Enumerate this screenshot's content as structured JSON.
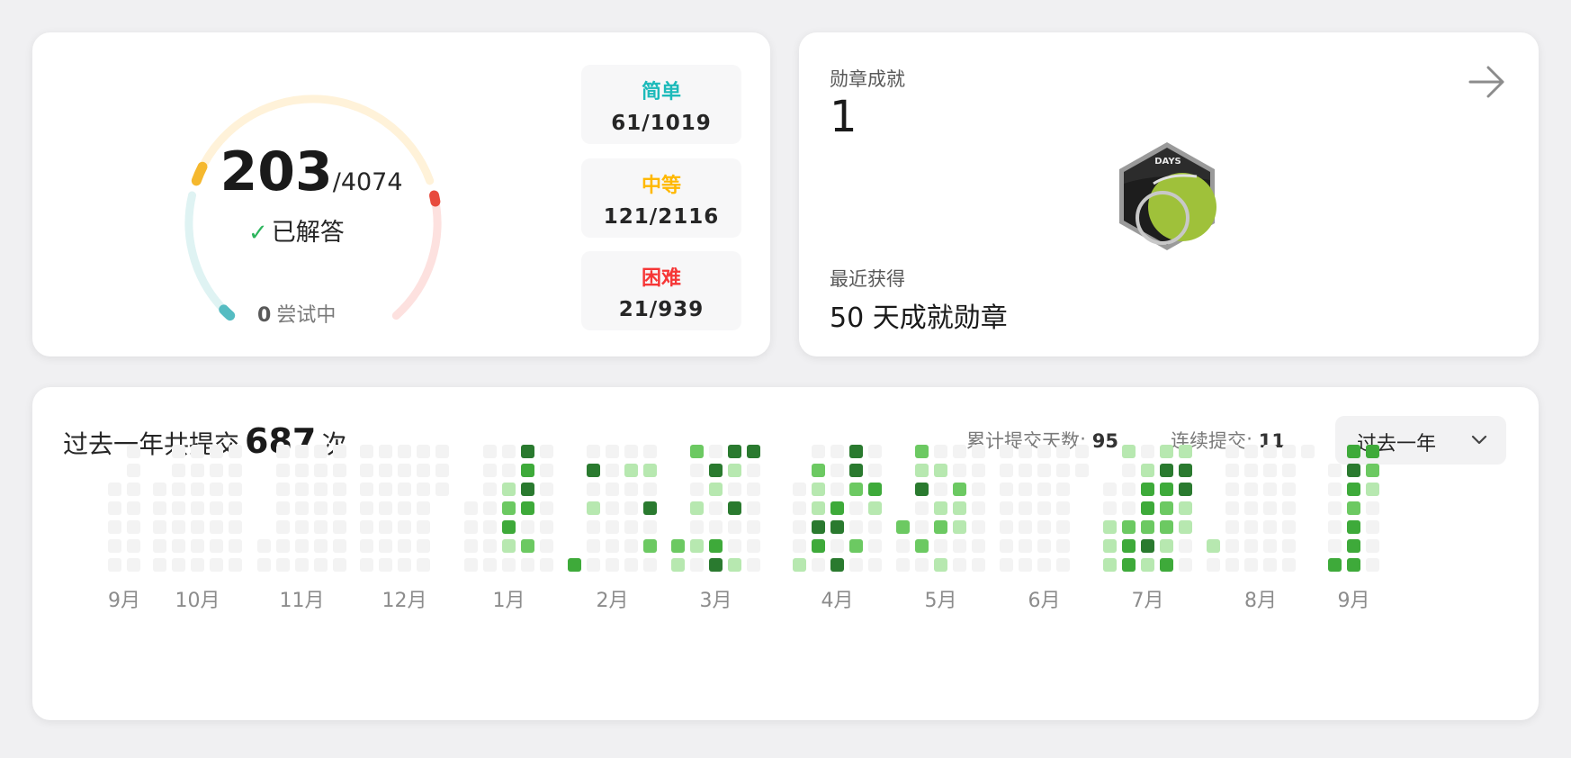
{
  "progress": {
    "solved": "203",
    "total": "/4074",
    "solved_label": "已解答",
    "attempting_count": "0",
    "attempting_label": "尝试中",
    "difficulties": [
      {
        "name": "简单",
        "value": "61/1019",
        "color": "#1cbaba"
      },
      {
        "name": "中等",
        "value": "121/2116",
        "color": "#ffb800"
      },
      {
        "name": "困难",
        "value": "21/939",
        "color": "#f63636"
      }
    ]
  },
  "badges": {
    "title": "勋章成就",
    "count": "1",
    "icon_text": "DAYS",
    "recent_label": "最近获得",
    "recent_name": "50 天成就勋章"
  },
  "calendar": {
    "title_prefix": "过去一年共提交",
    "total_submissions": "687",
    "title_suffix": "次",
    "stat_days_label": "累计提交天数:",
    "stat_days_value": "95",
    "stat_streak_label": "连续提交:",
    "stat_streak_value": "11",
    "range_label": "过去一年",
    "months": [
      "9月",
      "10月",
      "11月",
      "12月",
      "1月",
      "2月",
      "3月",
      "4月",
      "5月",
      "6月",
      "7月",
      "8月",
      "9月"
    ],
    "level_colors": [
      "#f3f3f3",
      "#b7e8b0",
      "#6cc962",
      "#3eaa3a",
      "#2a7a2f"
    ],
    "month_activity": [
      [],
      [],
      [],
      [],
      [
        [
          3,
          0,
          4
        ],
        [
          3,
          1,
          3
        ],
        [
          2,
          2,
          1
        ],
        [
          3,
          2,
          4
        ],
        [
          2,
          3,
          2
        ],
        [
          3,
          3,
          3
        ],
        [
          2,
          4,
          3
        ],
        [
          2,
          5,
          1
        ],
        [
          3,
          5,
          2
        ]
      ],
      [
        [
          0,
          6,
          3
        ],
        [
          1,
          1,
          4
        ],
        [
          3,
          1,
          1
        ],
        [
          4,
          1,
          1
        ],
        [
          1,
          3,
          1
        ],
        [
          4,
          3,
          4
        ],
        [
          4,
          5,
          2
        ]
      ],
      [
        [
          0,
          0,
          2
        ],
        [
          1,
          0,
          2
        ],
        [
          3,
          0,
          4
        ],
        [
          4,
          0,
          4
        ],
        [
          0,
          1,
          1
        ],
        [
          2,
          1,
          4
        ],
        [
          3,
          1,
          1
        ],
        [
          2,
          2,
          1
        ],
        [
          1,
          3,
          1
        ],
        [
          3,
          3,
          4
        ],
        [
          0,
          5,
          2
        ],
        [
          1,
          5,
          1
        ],
        [
          2,
          5,
          3
        ],
        [
          0,
          6,
          1
        ],
        [
          2,
          6,
          4
        ],
        [
          3,
          6,
          1
        ]
      ],
      [
        [
          3,
          0,
          4
        ],
        [
          1,
          1,
          2
        ],
        [
          3,
          1,
          4
        ],
        [
          1,
          2,
          1
        ],
        [
          3,
          2,
          2
        ],
        [
          4,
          2,
          3
        ],
        [
          1,
          3,
          1
        ],
        [
          2,
          3,
          3
        ],
        [
          4,
          3,
          1
        ],
        [
          1,
          4,
          4
        ],
        [
          2,
          4,
          4
        ],
        [
          1,
          5,
          3
        ],
        [
          3,
          5,
          2
        ],
        [
          0,
          6,
          1
        ],
        [
          2,
          6,
          4
        ]
      ],
      [
        [
          1,
          0,
          2
        ],
        [
          1,
          1,
          1
        ],
        [
          2,
          1,
          1
        ],
        [
          1,
          2,
          4
        ],
        [
          3,
          2,
          2
        ],
        [
          2,
          3,
          1
        ],
        [
          3,
          3,
          1
        ],
        [
          0,
          4,
          2
        ],
        [
          2,
          4,
          2
        ],
        [
          3,
          4,
          1
        ],
        [
          1,
          5,
          2
        ],
        [
          2,
          6,
          1
        ]
      ],
      [],
      [
        [
          1,
          0,
          1
        ],
        [
          3,
          0,
          1
        ],
        [
          4,
          0,
          1
        ],
        [
          2,
          1,
          1
        ],
        [
          3,
          1,
          4
        ],
        [
          4,
          1,
          4
        ],
        [
          2,
          2,
          3
        ],
        [
          3,
          2,
          3
        ],
        [
          4,
          2,
          4
        ],
        [
          2,
          3,
          3
        ],
        [
          3,
          3,
          2
        ],
        [
          4,
          3,
          1
        ],
        [
          0,
          4,
          1
        ],
        [
          1,
          4,
          2
        ],
        [
          2,
          4,
          2
        ],
        [
          3,
          4,
          2
        ],
        [
          4,
          4,
          1
        ],
        [
          0,
          5,
          1
        ],
        [
          1,
          5,
          3
        ],
        [
          2,
          5,
          4
        ],
        [
          3,
          5,
          1
        ],
        [
          0,
          6,
          1
        ],
        [
          1,
          6,
          3
        ],
        [
          2,
          6,
          1
        ],
        [
          3,
          6,
          3
        ]
      ],
      [
        [
          0,
          5,
          1
        ]
      ],
      [
        [
          1,
          0,
          3
        ],
        [
          2,
          0,
          3
        ],
        [
          1,
          1,
          4
        ],
        [
          2,
          1,
          2
        ],
        [
          1,
          2,
          3
        ],
        [
          2,
          2,
          1
        ],
        [
          1,
          3,
          2
        ],
        [
          1,
          4,
          3
        ],
        [
          1,
          5,
          3
        ],
        [
          0,
          6,
          3
        ],
        [
          1,
          6,
          3
        ]
      ]
    ]
  }
}
